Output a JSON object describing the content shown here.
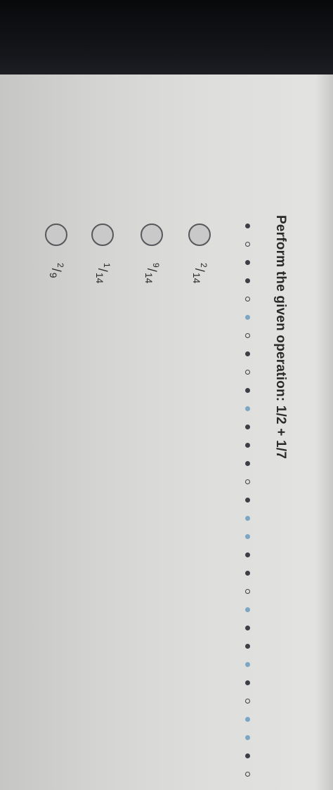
{
  "question": {
    "text": "Perform the given operation: 1/2 + 1/7"
  },
  "options": [
    {
      "numerator": "2",
      "denominator": "14"
    },
    {
      "numerator": "9",
      "denominator": "14"
    },
    {
      "numerator": "1",
      "denominator": "14"
    },
    {
      "numerator": "2",
      "denominator": "9"
    }
  ]
}
